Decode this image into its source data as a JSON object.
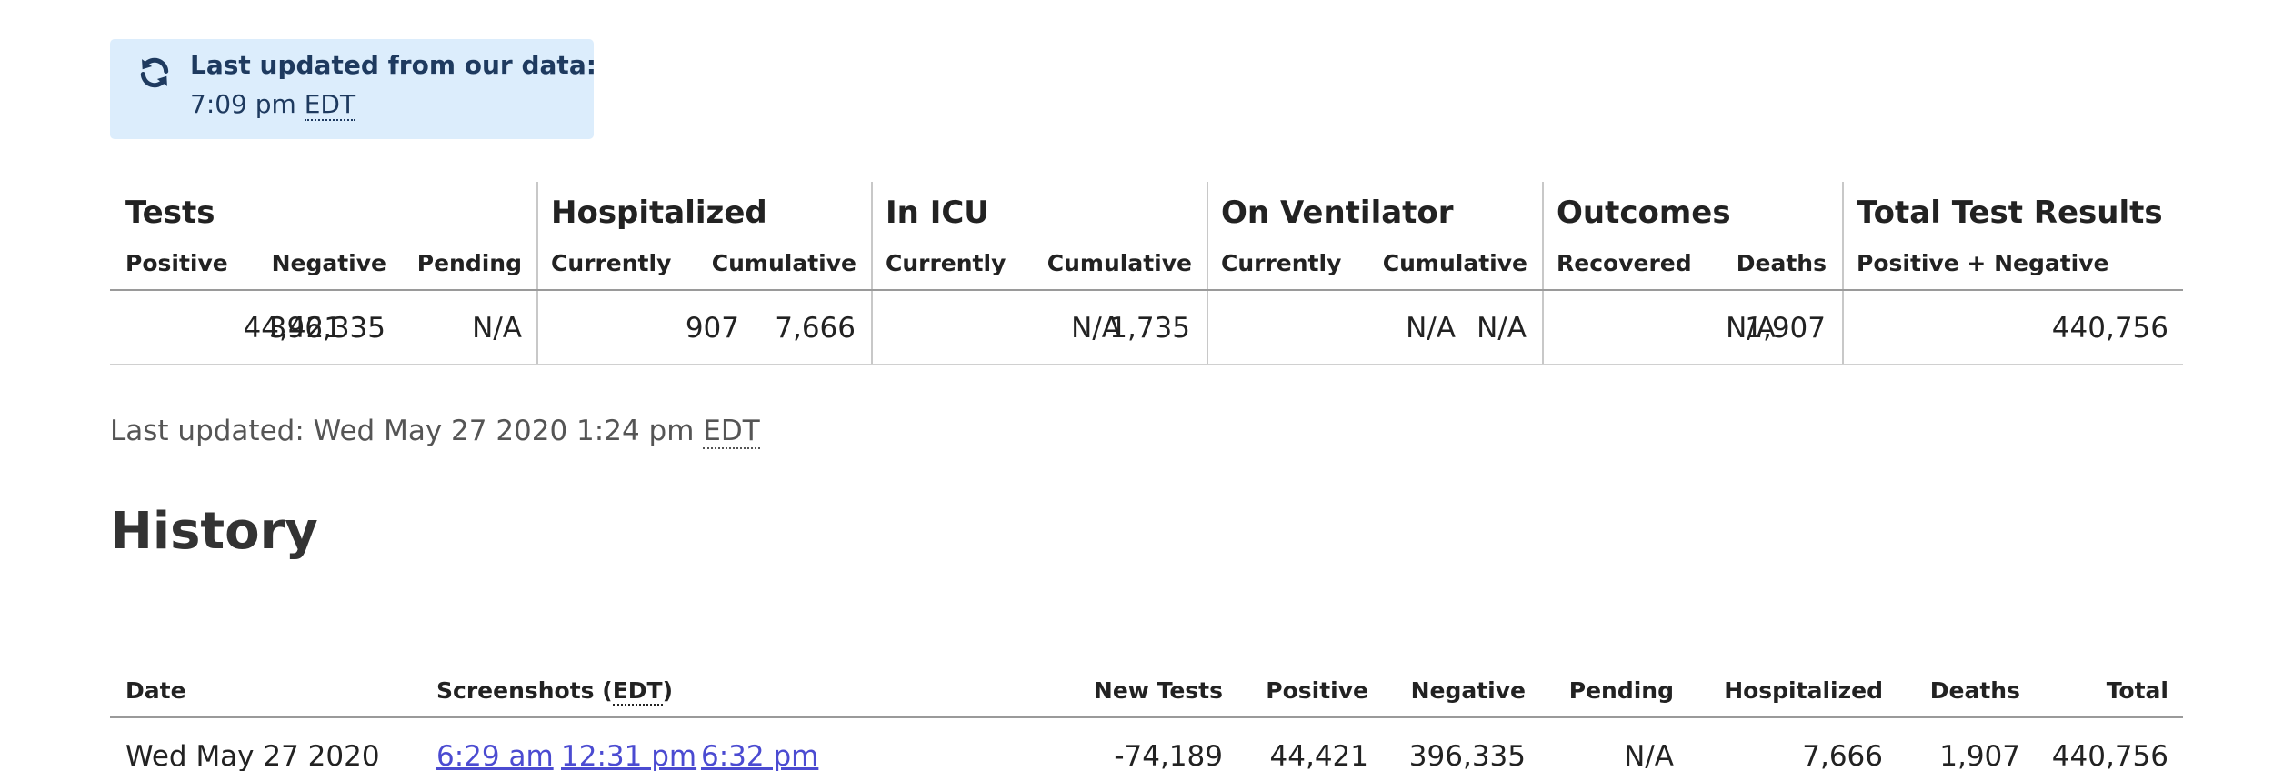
{
  "update_notice": {
    "icon": "refresh-icon",
    "title": "Last updated from our data:",
    "time": "7:09 pm",
    "tz": "EDT",
    "bg_color": "#dcedfc",
    "text_color": "#1e3a5f"
  },
  "summary": {
    "groups": {
      "tests": "Tests",
      "hospitalized": "Hospitalized",
      "icu": "In ICU",
      "ventilator": "On Ventilator",
      "outcomes": "Outcomes",
      "total": "Total Test Results"
    },
    "subheads": {
      "positive": "Positive",
      "negative": "Negative",
      "pending": "Pending",
      "hosp_current": "Currently",
      "hosp_cumulative": "Cumulative",
      "icu_current": "Currently",
      "icu_cumulative": "Cumulative",
      "vent_current": "Currently",
      "vent_cumulative": "Cumulative",
      "recovered": "Recovered",
      "deaths": "Deaths",
      "total": "Positive + Negative"
    },
    "values": {
      "positive": "44,421",
      "negative": "396,335",
      "pending": "N/A",
      "hosp_current": "907",
      "hosp_cumulative": "7,666",
      "icu_current": "N/A",
      "icu_cumulative": "1,735",
      "vent_current": "N/A",
      "vent_cumulative": "N/A",
      "recovered": "N/A",
      "deaths": "1,907",
      "total": "440,756"
    }
  },
  "last_updated": {
    "label": "Last updated: Wed May 27 2020 1:24 pm",
    "tz": "EDT"
  },
  "history": {
    "title": "History",
    "headers": {
      "date": "Date",
      "screenshots": "Screenshots (",
      "screenshots_tz": "EDT",
      "screenshots_close": ")",
      "new_tests": "New Tests",
      "positive": "Positive",
      "negative": "Negative",
      "pending": "Pending",
      "hospitalized": "Hospitalized",
      "deaths": "Deaths",
      "total": "Total"
    },
    "rows": [
      {
        "date": "Wed May 27 2020",
        "screenshots": [
          "6:29 am",
          "12:31 pm",
          "6:32 pm"
        ],
        "new_tests": "-74,189",
        "positive": "44,421",
        "negative": "396,335",
        "pending": "N/A",
        "hospitalized": "7,666",
        "deaths": "1,907",
        "total": "440,756"
      }
    ]
  },
  "colors": {
    "link": "#4b4bd1",
    "muted_text": "#555555",
    "border": "#c8c8c8"
  }
}
